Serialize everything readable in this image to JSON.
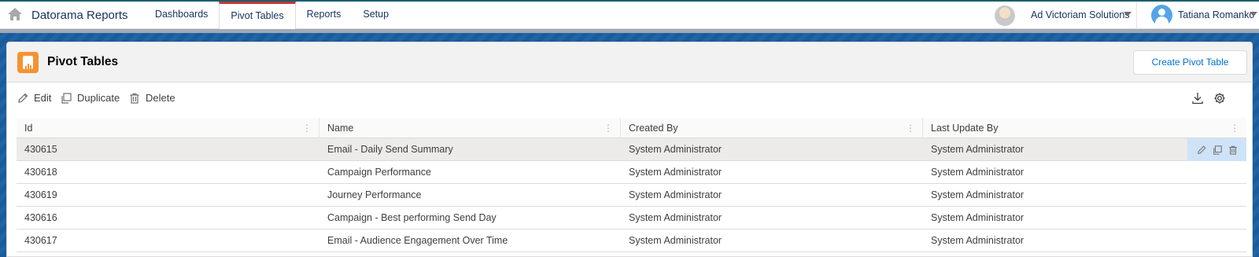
{
  "app": {
    "name": "Datorama Reports"
  },
  "nav": {
    "tabs": [
      {
        "label": "Dashboards",
        "active": false
      },
      {
        "label": "Pivot Tables",
        "active": true
      },
      {
        "label": "Reports",
        "active": false
      },
      {
        "label": "Setup",
        "active": false
      }
    ]
  },
  "account": {
    "org_name": "Ad Victoriam Solutions",
    "user_name": "Tatiana Romanko"
  },
  "page": {
    "title": "Pivot Tables",
    "create_label": "Create Pivot Table"
  },
  "toolbar": {
    "edit_label": "Edit",
    "duplicate_label": "Duplicate",
    "delete_label": "Delete"
  },
  "table": {
    "columns": [
      "Id",
      "Name",
      "Created By",
      "Last Update By"
    ],
    "rows": [
      {
        "id": "430615",
        "name": "Email - Daily Send Summary",
        "created_by": "System Administrator",
        "last_update_by": "System Administrator",
        "selected": true
      },
      {
        "id": "430618",
        "name": "Campaign Performance",
        "created_by": "System Administrator",
        "last_update_by": "System Administrator",
        "selected": false
      },
      {
        "id": "430619",
        "name": "Journey Performance",
        "created_by": "System Administrator",
        "last_update_by": "System Administrator",
        "selected": false
      },
      {
        "id": "430616",
        "name": "Campaign - Best performing Send Day",
        "created_by": "System Administrator",
        "last_update_by": "System Administrator",
        "selected": false
      },
      {
        "id": "430617",
        "name": "Email - Audience Engagement Over Time",
        "created_by": "System Administrator",
        "last_update_by": "System Administrator",
        "selected": false
      }
    ]
  },
  "icons": [
    "home-icon",
    "pencil-icon",
    "duplicate-icon",
    "trash-icon",
    "download-icon",
    "gear-icon",
    "chevron-down-icon"
  ],
  "colors": {
    "brand_blue": "#0070d2",
    "active_tab": "#c23934",
    "object_icon": "#f59331",
    "row_action_bg": "#cfe3f8"
  }
}
